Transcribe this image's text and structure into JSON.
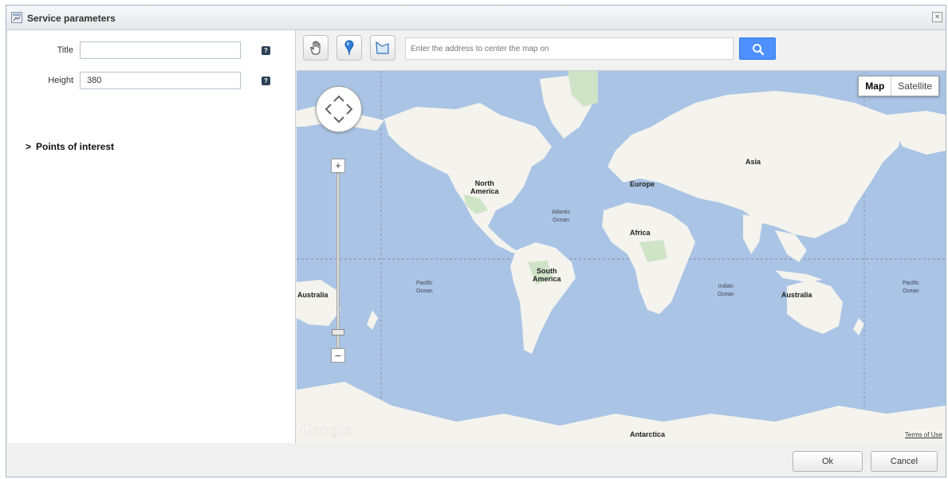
{
  "dialog": {
    "title": "Service parameters",
    "close_glyph": "×"
  },
  "form": {
    "title_label": "Title",
    "title_value": "",
    "height_label": "Height",
    "height_value": "380",
    "help_glyph": "?",
    "poi_label": "Points of interest",
    "poi_arrow": ">"
  },
  "toolbar": {
    "tools": [
      "hand-pan-icon",
      "marker-pin-icon",
      "polygon-shape-icon"
    ],
    "address_placeholder": "Enter the address to center the map on",
    "search_icon": "search-icon"
  },
  "map": {
    "map_type_active": "Map",
    "map_type_other": "Satellite",
    "zoom_in": "+",
    "zoom_out": "−",
    "logo": "Google",
    "terms": "Terms of Use",
    "labels": {
      "north_america_1": "North",
      "north_america_2": "America",
      "south_america_1": "South",
      "south_america_2": "America",
      "europe": "Europe",
      "asia": "Asia",
      "africa": "Africa",
      "australia_left": "Australia",
      "australia_right": "Australia",
      "antarctica": "Antarctica",
      "atlantic_1": "Atlantic",
      "atlantic_2": "Ocean",
      "pacific_left_1": "Pacific",
      "pacific_left_2": "Ocean",
      "indian_1": "Indian",
      "indian_2": "Ocean",
      "pacific_right_1": "Pacific",
      "pacific_right_2": "Ocean"
    }
  },
  "footer": {
    "ok_label": "Ok",
    "cancel_label": "Cancel"
  }
}
